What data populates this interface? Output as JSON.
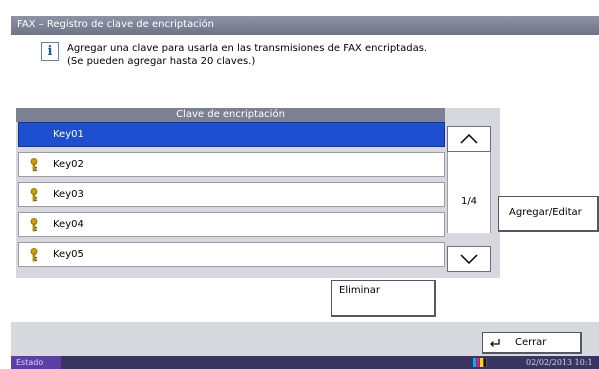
{
  "title": "FAX – Registro de clave de encriptación",
  "info": {
    "line1": "Agregar una clave para usarla en las transmisiones de FAX encriptadas.",
    "line2": "(Se pueden agregar hasta 20 claves.)"
  },
  "list": {
    "header": "Clave de encriptación",
    "items": [
      {
        "label": "Key01",
        "selected": true,
        "icon": "key-icon"
      },
      {
        "label": "Key02",
        "selected": false,
        "icon": "key-icon"
      },
      {
        "label": "Key03",
        "selected": false,
        "icon": "key-icon"
      },
      {
        "label": "Key04",
        "selected": false,
        "icon": "key-icon"
      },
      {
        "label": "Key05",
        "selected": false,
        "icon": "key-icon"
      }
    ],
    "page": "1/4"
  },
  "buttons": {
    "add_edit": "Agregar/Editar",
    "delete": "Eliminar",
    "close": "Cerrar"
  },
  "status": {
    "label": "Estado",
    "datetime": "02/02/2013  10:1"
  },
  "colors": {
    "selected_row": "#1e4fd0",
    "title_bar": "#7c8093",
    "key_icon": "#c9a400"
  }
}
